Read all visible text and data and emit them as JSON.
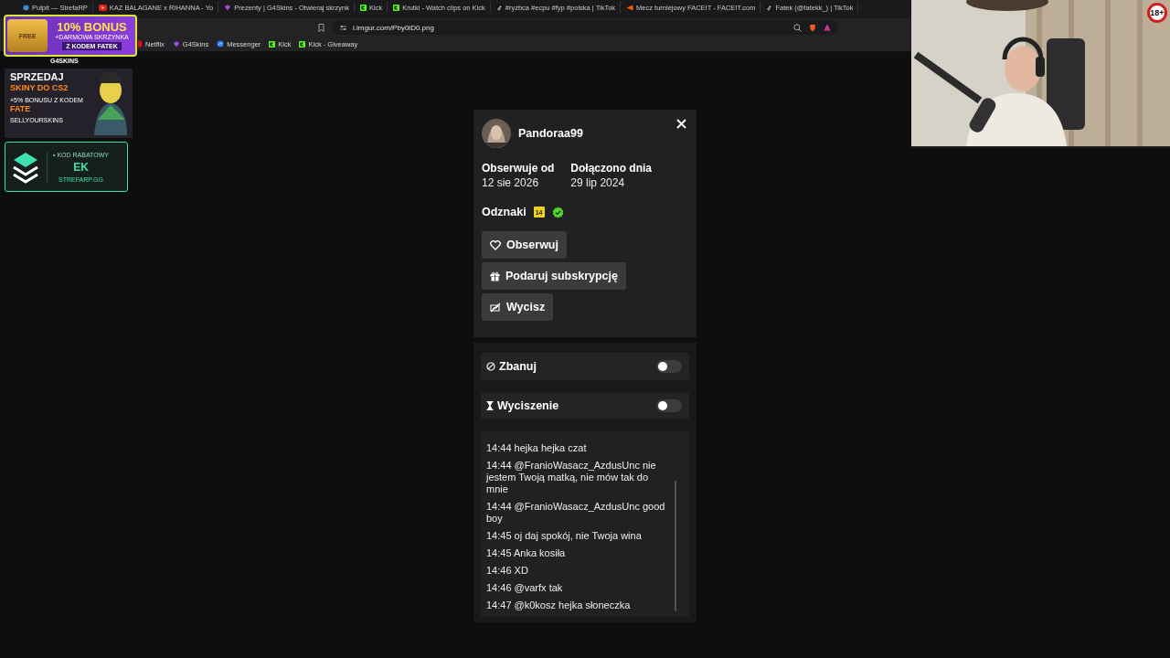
{
  "browser": {
    "tabs": [
      {
        "title": "Pulpit — StrefaRP",
        "kind": "globe",
        "selected": false
      },
      {
        "title": "KAZ BALAGANE x RIHANNA - Yo",
        "kind": "youtube",
        "selected": false
      },
      {
        "title": "Prezenty | G4Skins - Otwieraj skrzynk",
        "kind": "gem",
        "selected": false
      },
      {
        "title": "Kick",
        "kind": "kick",
        "selected": false
      },
      {
        "title": "Krutki - Watch clips on Kick",
        "kind": "kick",
        "selected": false
      },
      {
        "title": "#ryzbca #ecpu #fyp #polska | TikTok",
        "kind": "tiktok",
        "selected": false
      },
      {
        "title": "Mecz turniejowy FACEIT - FACEIT.com",
        "kind": "faceit",
        "selected": false
      },
      {
        "title": "Fatek (@fatekk_) | TikTok",
        "kind": "tiktok",
        "selected": false
      }
    ],
    "address": "i.imgur.com/Pby0iD0.png",
    "bookmarks": [
      {
        "label": "Netflix",
        "kind": "netflix"
      },
      {
        "label": "G4Skins",
        "kind": "gem"
      },
      {
        "label": "Messenger",
        "kind": "messenger"
      },
      {
        "label": "Kick",
        "kind": "kick"
      },
      {
        "label": "Kick - Giveaway",
        "kind": "kick"
      }
    ]
  },
  "user_card": {
    "username": "Pandoraa99",
    "stats": [
      {
        "label": "Obserwuje od",
        "value": "12 sie 2026"
      },
      {
        "label": "Dołączono dnia",
        "value": "29 lip 2024"
      }
    ],
    "badges_label": "Odznaki",
    "badges": [
      {
        "kind": "subscriber",
        "text": "14"
      },
      {
        "kind": "verified"
      }
    ],
    "actions": [
      {
        "label": "Obserwuj",
        "kind": "heart"
      },
      {
        "label": "Podaruj subskrypcję",
        "kind": "gift"
      },
      {
        "label": "Wycisz",
        "kind": "mute"
      }
    ],
    "moderation": [
      {
        "label": "Zbanuj",
        "kind": "ban",
        "on": false
      },
      {
        "label": "Wyciszenie",
        "kind": "hourglass",
        "on": false
      }
    ],
    "messages": [
      {
        "time": "14:44",
        "text": "hejka hejka czat"
      },
      {
        "time": "14:44",
        "text": "@FranioWasacz_AzdusUnc nie jestem Twoją matką, nie mów tak do mnie"
      },
      {
        "time": "14:44",
        "text": "@FranioWasacz_AzdusUnc good boy"
      },
      {
        "time": "14:45",
        "text": "oj daj spokój, nie Twoja wina"
      },
      {
        "time": "14:45",
        "text": "Anka kosiła"
      },
      {
        "time": "14:46",
        "text": "XD"
      },
      {
        "time": "14:46",
        "text": "@varfx tak"
      },
      {
        "time": "14:47",
        "text": "@k0kosz hejka słoneczka"
      }
    ]
  },
  "overlays": {
    "ads": [
      {
        "kind": "chest",
        "chest_label": "FREE",
        "headline": "10% BONUS",
        "subline": "+DARMOWA SKRZYNKA",
        "code": "Z KODEM FATEK",
        "brand": "G4SKINS"
      },
      {
        "kind": "sell",
        "lines": [
          "SPRZEDAJ",
          "SKINY DO CS2"
        ],
        "bonus": "+5% BONUSU Z KODEM",
        "code": "FATE",
        "brand": "SELLYOURSKINS"
      },
      {
        "kind": "discount",
        "caption": "• KOD RABATOWY",
        "code": "EK",
        "site": "STREFARP.GG"
      }
    ]
  },
  "webcam": {
    "kind": "picture",
    "age_badge": "18+"
  }
}
